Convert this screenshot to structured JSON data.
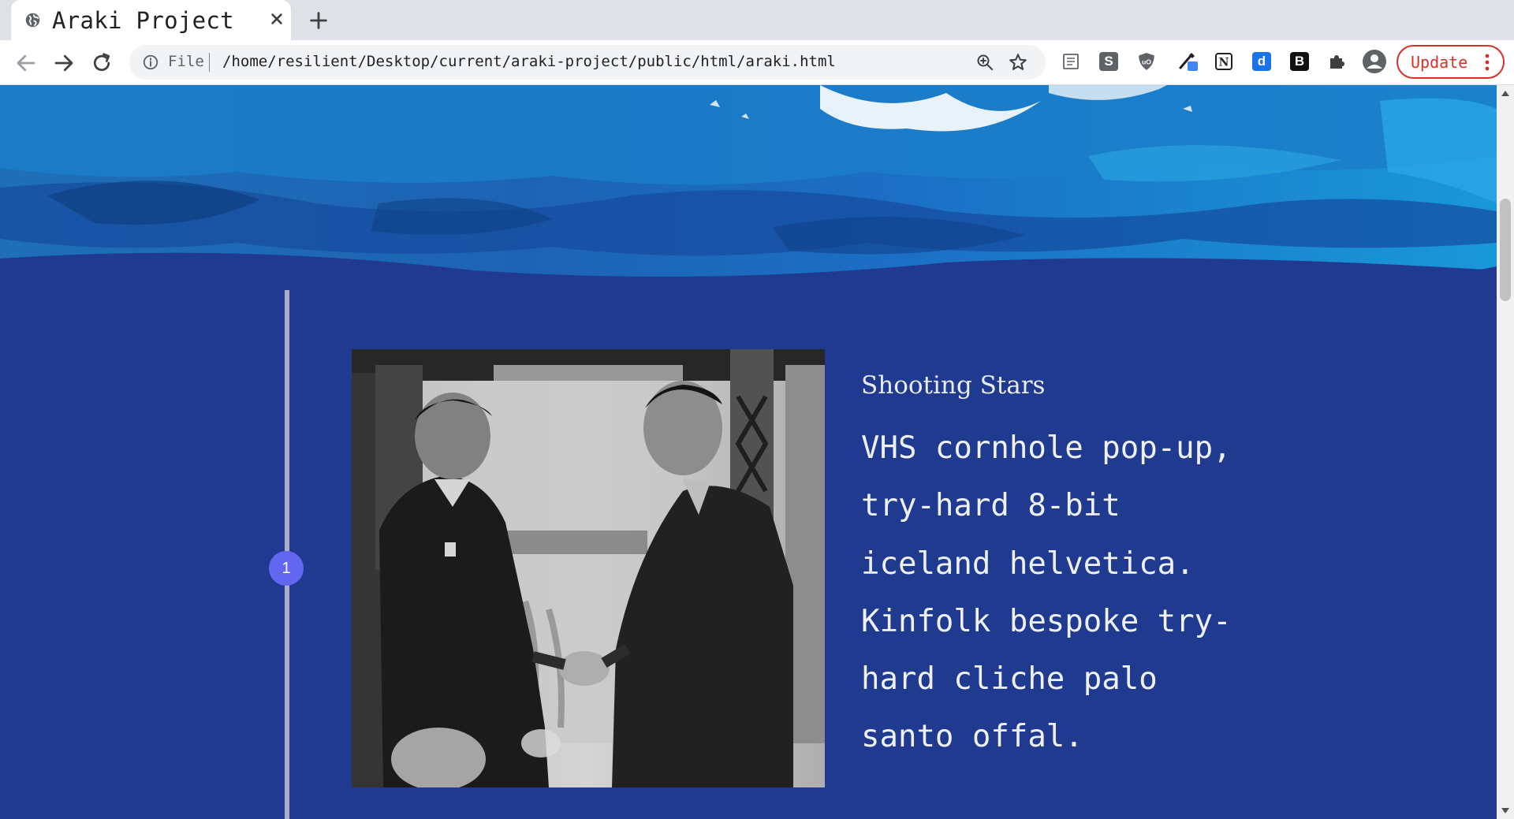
{
  "browser": {
    "tab": {
      "title": "Araki Project"
    },
    "omnibox": {
      "scheme_label": "File",
      "url": "/home/resilient/Desktop/current/araki-project/public/html/araki.html"
    },
    "extensions": [
      {
        "name": "reader-icon",
        "glyph": "≡"
      },
      {
        "name": "s-extension-icon",
        "glyph": "S"
      },
      {
        "name": "ublock-icon",
        "glyph": "uO"
      },
      {
        "name": "eyedropper-icon",
        "glyph": ""
      },
      {
        "name": "notion-icon",
        "glyph": "N"
      },
      {
        "name": "d-extension-icon",
        "glyph": "d"
      },
      {
        "name": "b-extension-icon",
        "glyph": "B"
      }
    ],
    "update_label": "Update"
  },
  "page": {
    "timeline": [
      {
        "number": "1",
        "title": "Shooting Stars",
        "body": "VHS cornhole pop-up, try-hard 8-bit iceland helvetica. Kinfolk bespoke try-hard cliche palo santo offal."
      }
    ]
  },
  "colors": {
    "page_background": "#1f3a8f",
    "timeline_dot": "#6366f1",
    "timeline_line": "#a9b0c4",
    "update_accent": "#d93025"
  }
}
